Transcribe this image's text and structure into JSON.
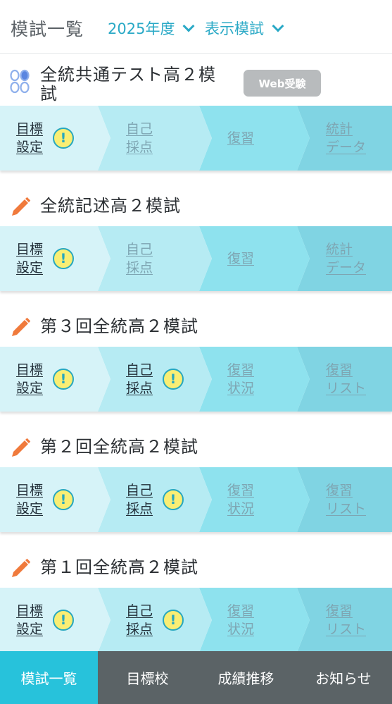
{
  "header": {
    "title": "模試一覧",
    "year_select": "2025年度",
    "display_select": "表示模試"
  },
  "exams": [
    {
      "title_lines": [
        "全統共通テスト高２模",
        "試"
      ],
      "badge": "Web受験",
      "steps": [
        {
          "lines": [
            "目標",
            "設定"
          ],
          "warn": true,
          "dim": false
        },
        {
          "lines": [
            "自己",
            "採点"
          ],
          "warn": false,
          "dim": true
        },
        {
          "lines": [
            "復習"
          ],
          "warn": false,
          "dim": true
        },
        {
          "lines": [
            "統計",
            "データ"
          ],
          "warn": false,
          "dim": true
        }
      ]
    },
    {
      "title_lines": [
        "全統記述高２模試"
      ],
      "steps": [
        {
          "lines": [
            "目標",
            "設定"
          ],
          "warn": true,
          "dim": false
        },
        {
          "lines": [
            "自己",
            "採点"
          ],
          "warn": false,
          "dim": true
        },
        {
          "lines": [
            "復習"
          ],
          "warn": false,
          "dim": true
        },
        {
          "lines": [
            "統計",
            "データ"
          ],
          "warn": false,
          "dim": true
        }
      ]
    },
    {
      "title_lines": [
        "第３回全統高２模試"
      ],
      "steps": [
        {
          "lines": [
            "目標",
            "設定"
          ],
          "warn": true,
          "dim": false
        },
        {
          "lines": [
            "自己",
            "採点"
          ],
          "warn": true,
          "dim": false
        },
        {
          "lines": [
            "復習",
            "状況"
          ],
          "warn": false,
          "dim": true
        },
        {
          "lines": [
            "復習",
            "リスト"
          ],
          "warn": false,
          "dim": true
        }
      ]
    },
    {
      "title_lines": [
        "第２回全統高２模試"
      ],
      "steps": [
        {
          "lines": [
            "目標",
            "設定"
          ],
          "warn": true,
          "dim": false
        },
        {
          "lines": [
            "自己",
            "採点"
          ],
          "warn": true,
          "dim": false
        },
        {
          "lines": [
            "復習",
            "状況"
          ],
          "warn": false,
          "dim": true
        },
        {
          "lines": [
            "復習",
            "リスト"
          ],
          "warn": false,
          "dim": true
        }
      ]
    },
    {
      "title_lines": [
        "第１回全統高２模試"
      ],
      "steps": [
        {
          "lines": [
            "目標",
            "設定"
          ],
          "warn": true,
          "dim": false
        },
        {
          "lines": [
            "自己",
            "採点"
          ],
          "warn": true,
          "dim": false
        },
        {
          "lines": [
            "復習",
            "状況"
          ],
          "warn": false,
          "dim": true
        },
        {
          "lines": [
            "復習",
            "リスト"
          ],
          "warn": false,
          "dim": true
        }
      ]
    }
  ],
  "warn_symbol": "!",
  "icons": {
    "web_exam": "circles-icon",
    "written_exam": "pencil-icon",
    "warning": "exclamation-icon",
    "dropdown": "chevron-down-icon"
  },
  "colors": {
    "accent": "#27c2db",
    "step1": "#d6f3f8",
    "step2": "#b6ebf3",
    "step3": "#8ee2ee",
    "step4": "#80d4e3",
    "pencil": "#f07a3c",
    "warn_fill": "#f9ee74"
  },
  "bottom_nav": [
    {
      "label": "模試一覧",
      "active": true
    },
    {
      "label": "目標校",
      "active": false
    },
    {
      "label": "成績推移",
      "active": false
    },
    {
      "label": "お知らせ",
      "active": false
    }
  ]
}
